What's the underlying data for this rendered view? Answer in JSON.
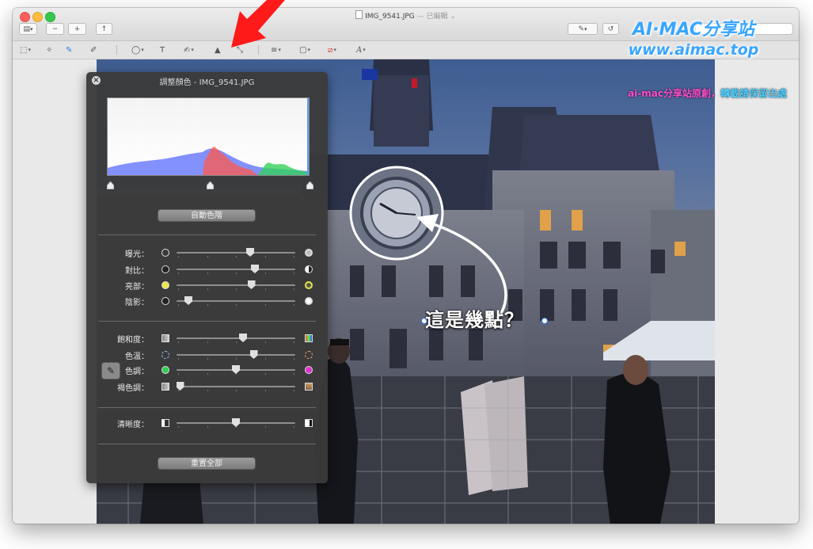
{
  "window": {
    "filename": "IMG_9541.JPG",
    "edited_status": " — 已編輯 ",
    "chevron": "⌄"
  },
  "toolbar": {
    "sidebar_icon": "▤",
    "zoom_out_icon": "−",
    "zoom_in_icon": "+",
    "share_icon": "↑",
    "markup_icon": "✎",
    "rotate_icon": "↺"
  },
  "markup_tools": [
    {
      "name": "selection",
      "glyph": "⬚"
    },
    {
      "name": "instant-alpha",
      "glyph": "✧"
    },
    {
      "name": "sketch",
      "glyph": "✎"
    },
    {
      "name": "draw",
      "glyph": "✐"
    },
    {
      "name": "shapes",
      "glyph": "◯"
    },
    {
      "name": "text",
      "glyph": "T"
    },
    {
      "name": "sign",
      "glyph": "✍"
    },
    {
      "name": "adjust-color",
      "glyph": "▲"
    },
    {
      "name": "adjust-size",
      "glyph": "⤡"
    },
    {
      "name": "shape-style",
      "glyph": "≡"
    },
    {
      "name": "border-color",
      "glyph": "▢"
    },
    {
      "name": "fill-color",
      "glyph": "⧄"
    },
    {
      "name": "text-style",
      "glyph": "A"
    }
  ],
  "watermark": {
    "line1": "AI·MAC分享站",
    "line2": "www.aimac.top",
    "line3_a": "ai-mac分享站原創，",
    "line3_b": "轉載請保留出處"
  },
  "annotation": {
    "text": "這是幾點？"
  },
  "panel": {
    "title": "調整顏色 - IMG_9541.JPG",
    "close_icon": "×",
    "auto_levels_label": "自動色階",
    "reset_all_label": "重置全部",
    "histogram_levels": {
      "black": 0.0,
      "mid": 0.5,
      "white": 1.0
    },
    "sliders": [
      {
        "key": "exposure",
        "label": "曝光：",
        "value": 0.62,
        "left_icon": "sun-small-icon",
        "right_icon": "sun-large-icon"
      },
      {
        "key": "contrast",
        "label": "對比：",
        "value": 0.66,
        "left_icon": "circle-dark-icon",
        "right_icon": "circle-half-icon"
      },
      {
        "key": "highlights",
        "label": "亮部：",
        "value": 0.63,
        "left_icon": "dot-yellow-icon",
        "right_icon": "dot-yellow-ring-icon"
      },
      {
        "key": "shadows",
        "label": "陰影：",
        "value": 0.1,
        "left_icon": "dot-dark-icon",
        "right_icon": "dot-light-icon"
      },
      {
        "key": "saturation",
        "label": "飽和度：",
        "value": 0.56,
        "left_icon": "square-gray-icon",
        "right_icon": "square-color-icon"
      },
      {
        "key": "temperature",
        "label": "色溫：",
        "value": 0.65,
        "left_icon": "sun-blue-icon",
        "right_icon": "sun-orange-icon"
      },
      {
        "key": "tint",
        "label": "色調：",
        "value": 0.5,
        "left_icon": "dot-green-icon",
        "right_icon": "dot-magenta-icon"
      },
      {
        "key": "sepia",
        "label": "褐色調：",
        "value": 0.03,
        "left_icon": "square-gray-icon",
        "right_icon": "square-sepia-icon"
      },
      {
        "key": "sharpness",
        "label": "清晰度：",
        "value": 0.5,
        "left_icon": "sharp-low-icon",
        "right_icon": "sharp-high-icon"
      }
    ]
  },
  "colors": {
    "accent_arrow": "#ff1a1a",
    "watermark_blue": "#39a6ff",
    "histogram_red": "#ff5a4a",
    "histogram_green": "#33d25a",
    "histogram_blue": "#5a6cff"
  }
}
